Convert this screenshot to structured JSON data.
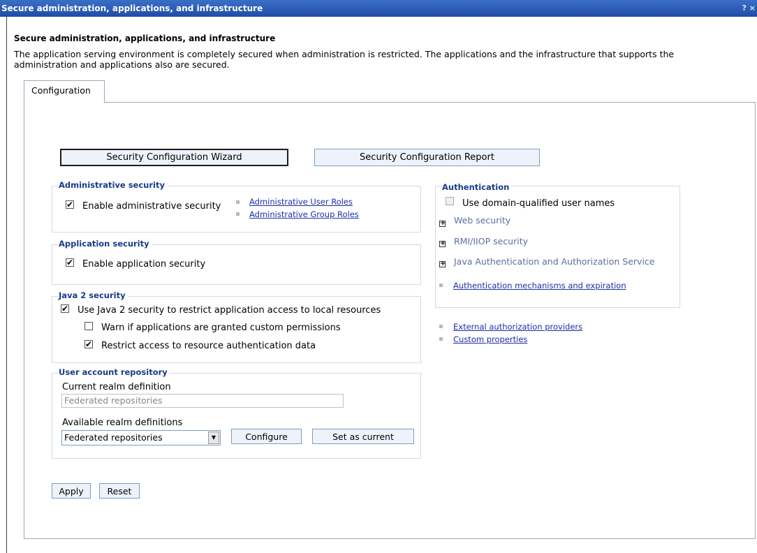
{
  "window": {
    "title": "Secure administration, applications, and infrastructure",
    "controls": "? ×"
  },
  "page": {
    "title": "Secure administration, applications, and infrastructure",
    "description": "The application serving environment is completely secured when administration is restricted. The applications and the infrastructure that supports the administration and applications also are secured."
  },
  "tabs": [
    {
      "label": "Configuration"
    }
  ],
  "wizard_buttons": {
    "wizard": "Security Configuration Wizard",
    "report": "Security Configuration Report"
  },
  "admin_security": {
    "title": "Administrative security",
    "enable_label": "Enable administrative security",
    "enable_checked": true,
    "links": [
      "Administrative User Roles",
      "Administrative Group Roles"
    ]
  },
  "app_security": {
    "title": "Application security",
    "enable_label": "Enable application security",
    "enable_checked": true
  },
  "java2_security": {
    "title": "Java 2 security",
    "use_label": "Use Java 2 security to restrict application access to local resources",
    "use_checked": true,
    "warn_label": "Warn if applications are granted custom permissions",
    "warn_checked": false,
    "restrict_label": "Restrict access to resource authentication data",
    "restrict_checked": true
  },
  "user_repo": {
    "title": "User account repository",
    "current_label": "Current realm definition",
    "current_value": "Federated repositories",
    "available_label": "Available realm definitions",
    "available_selected": "Federated repositories",
    "configure_button": "Configure",
    "set_current_button": "Set as current"
  },
  "authentication": {
    "title": "Authentication",
    "domain_label": "Use domain-qualified user names",
    "domain_checked": false,
    "tree_items": [
      "Web security",
      "RMI/IIOP security",
      "Java Authentication and Authorization Service"
    ],
    "mechanisms_link": "Authentication mechanisms and expiration"
  },
  "other_links": [
    "External authorization providers",
    "Custom properties"
  ],
  "actions": {
    "apply": "Apply",
    "reset": "Reset"
  },
  "icons": {
    "check": "✔",
    "expand": "+",
    "dropdown": "▼"
  }
}
